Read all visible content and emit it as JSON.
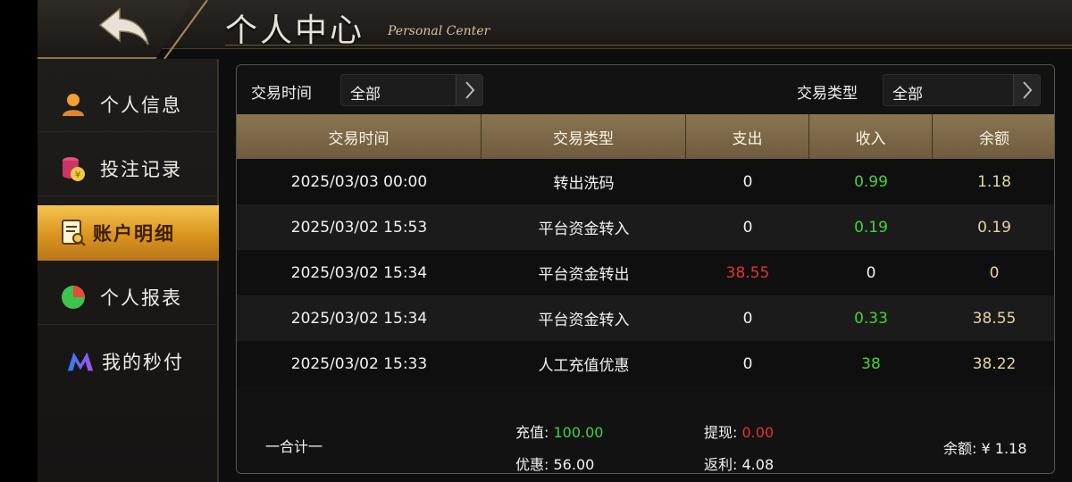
{
  "header": {
    "title": "个人中心",
    "subtitle": "Personal Center"
  },
  "sidebar": {
    "items": [
      {
        "label": "个人信息",
        "icon": "user-icon"
      },
      {
        "label": "投注记录",
        "icon": "coins-icon"
      },
      {
        "label": "账户明细",
        "icon": "statement-search-icon",
        "active": true
      },
      {
        "label": "个人报表",
        "icon": "pie-chart-icon"
      },
      {
        "label": "我的秒付",
        "icon": "m-logo-icon"
      }
    ]
  },
  "filters": {
    "time_label": "交易时间",
    "time_value": "全部",
    "type_label": "交易类型",
    "type_value": "全部"
  },
  "table": {
    "columns": [
      "交易时间",
      "交易类型",
      "支出",
      "收入",
      "余额"
    ],
    "rows": [
      {
        "time": "2025/03/03 00:00",
        "type": "转出洗码",
        "out": "0",
        "in": "0.99",
        "balance": "1.18"
      },
      {
        "time": "2025/03/02 15:53",
        "type": "平台资金转入",
        "out": "0",
        "in": "0.19",
        "balance": "0.19"
      },
      {
        "time": "2025/03/02 15:34",
        "type": "平台资金转出",
        "out": "38.55",
        "in": "0",
        "balance": "0"
      },
      {
        "time": "2025/03/02 15:34",
        "type": "平台资金转入",
        "out": "0",
        "in": "0.33",
        "balance": "38.55"
      },
      {
        "time": "2025/03/02 15:33",
        "type": "人工充值优惠",
        "out": "0",
        "in": "38",
        "balance": "38.22"
      }
    ]
  },
  "summary": {
    "total_label": "一合计一",
    "recharge_label": "充值:",
    "recharge_value": "100.00",
    "withdraw_label": "提现:",
    "withdraw_value": "0.00",
    "bonus_label": "优惠:",
    "bonus_value": "56.00",
    "rebate_label": "返利:",
    "rebate_value": "4.08",
    "balance_label": "余额:",
    "balance_value": "¥ 1.18"
  },
  "colors": {
    "accent_gold": "#d9941e",
    "income_green": "#43d33a",
    "expense_red": "#e2332e",
    "balance_gold": "#e6d3a3",
    "header_bar": "#7c6848"
  }
}
